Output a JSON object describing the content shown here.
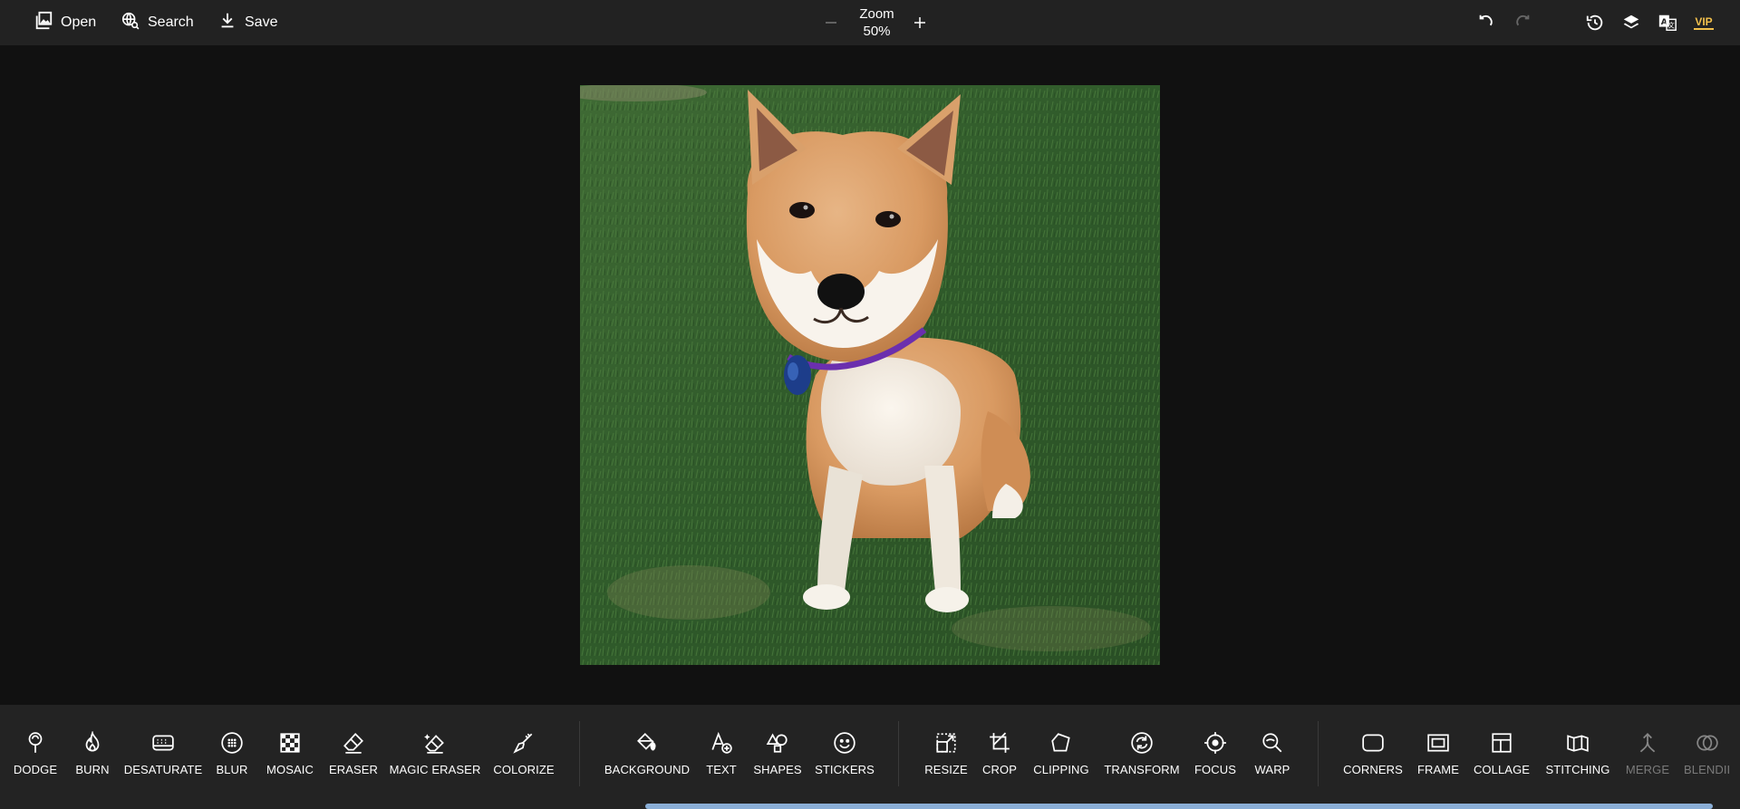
{
  "topbar": {
    "open_label": "Open",
    "search_label": "Search",
    "save_label": "Save",
    "zoom_label": "Zoom",
    "zoom_value": "50%",
    "vip_label": "VIP",
    "icons": [
      "undo-icon",
      "redo-icon",
      "history-icon",
      "layers-icon",
      "translate-icon",
      "vip-icon"
    ]
  },
  "canvas": {
    "image_subject": "shiba-inu-dog-on-grass"
  },
  "toolbar": {
    "group1": [
      "DODGE",
      "BURN",
      "DESATURATE",
      "BLUR",
      "MOSAIC",
      "ERASER",
      "MAGIC ERASER",
      "COLORIZE"
    ],
    "group2": [
      "BACKGROUND",
      "TEXT",
      "SHAPES",
      "STICKERS"
    ],
    "group3": [
      "RESIZE",
      "CROP",
      "CLIPPING",
      "TRANSFORM",
      "FOCUS",
      "WARP"
    ],
    "group4": [
      "CORNERS",
      "FRAME",
      "COLLAGE",
      "STITCHING",
      "MERGE",
      "BLENDII"
    ]
  },
  "colors": {
    "topbar_bg": "#222222",
    "canvas_bg": "#111111",
    "toolbar_bg": "#232323",
    "vip_accent": "#f2c04c",
    "scrollbar": "#8aaed6"
  }
}
